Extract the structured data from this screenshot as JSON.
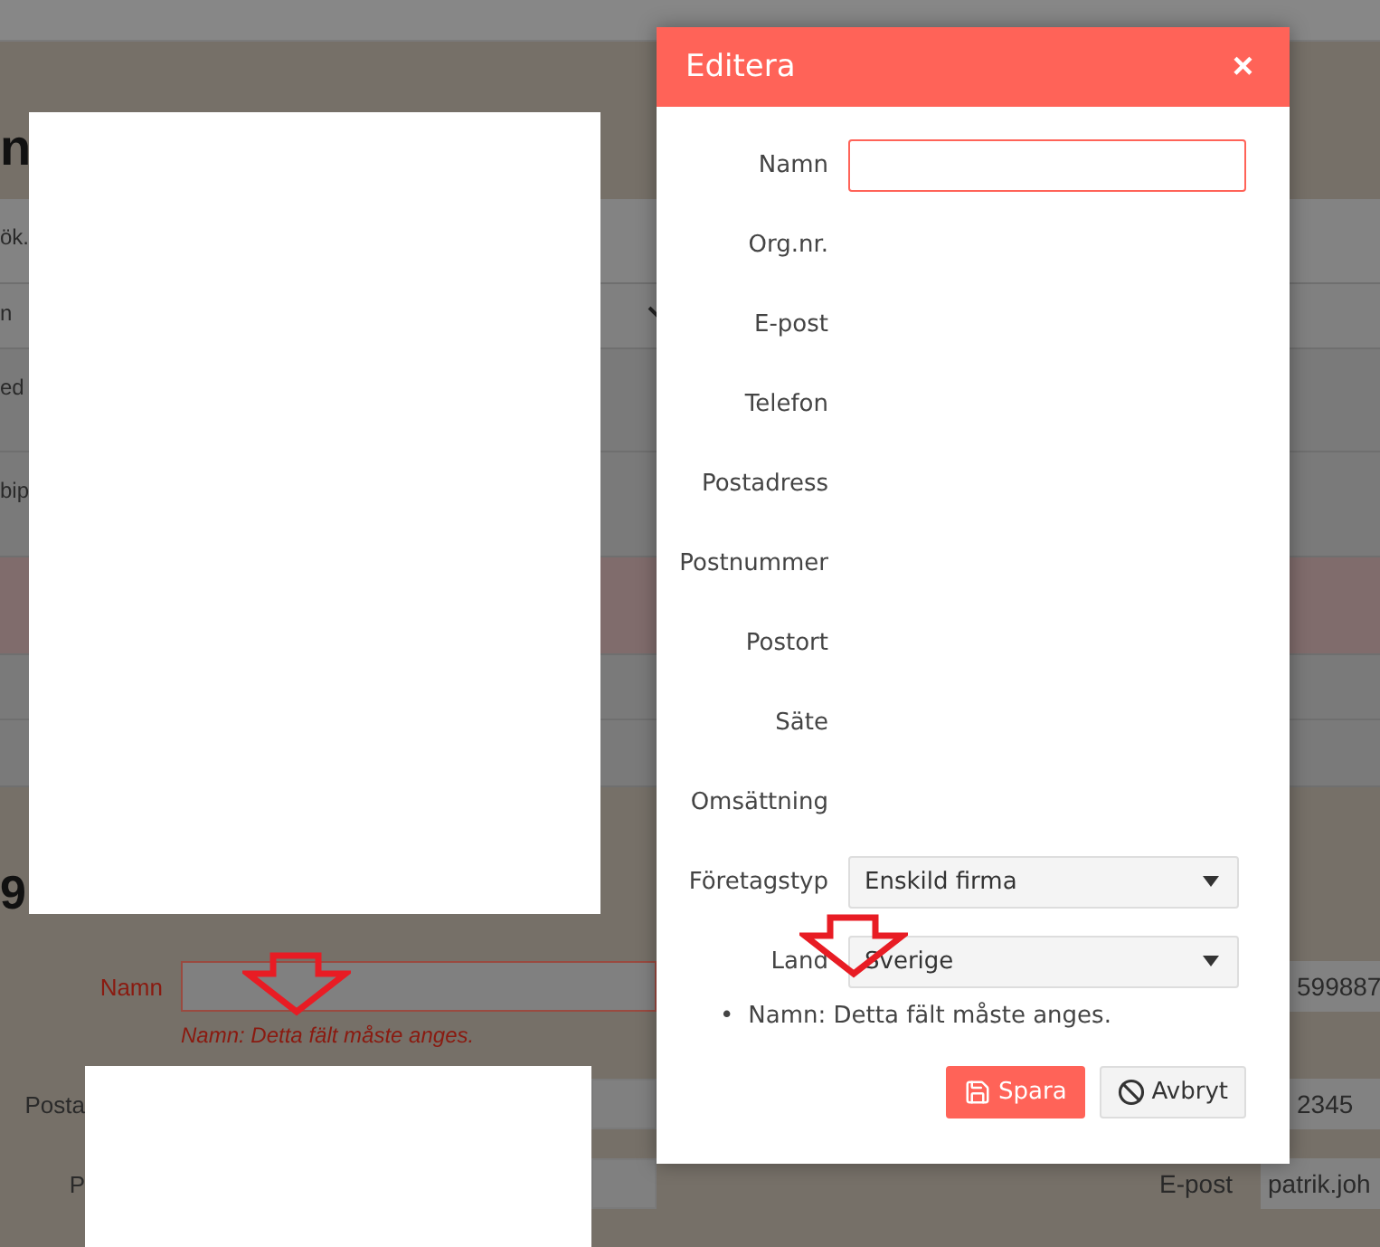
{
  "background": {
    "heading": "n",
    "rows": [
      {
        "kind": "search",
        "text": "ök.",
        "highlighted": false
      },
      {
        "kind": "dropdown",
        "text": "n",
        "highlighted": false
      },
      {
        "kind": "row",
        "text": "ed",
        "highlighted": false
      },
      {
        "kind": "row",
        "text": "bip",
        "highlighted": false
      },
      {
        "kind": "row",
        "highlighted": true
      },
      {
        "kind": "row",
        "highlighted": false
      },
      {
        "kind": "row",
        "highlighted": false
      }
    ],
    "form": {
      "heading": "9",
      "rows": [
        {
          "left_label": "Namn",
          "invalid": true,
          "error": "Namn: Detta fält måste anges.",
          "right_value": "599887"
        },
        {
          "left_label": "Posta",
          "invalid": false,
          "right_value": "2345"
        },
        {
          "left_label": "P",
          "invalid": false,
          "right_label": "E-post",
          "right_value": "patrik.joh"
        }
      ]
    }
  },
  "modal": {
    "title": "Editera",
    "close": "×",
    "fields": [
      {
        "label": "Namn",
        "kind": "input",
        "invalid": true
      },
      {
        "label": "Org.nr.",
        "kind": "blank"
      },
      {
        "label": "E-post",
        "kind": "blank"
      },
      {
        "label": "Telefon",
        "kind": "blank"
      },
      {
        "label": "Postadress",
        "kind": "blank"
      },
      {
        "label": "Postnummer",
        "kind": "blank"
      },
      {
        "label": "Postort",
        "kind": "blank"
      },
      {
        "label": "Säte",
        "kind": "blank"
      },
      {
        "label": "Omsättning",
        "kind": "blank"
      },
      {
        "label": "Företagstyp",
        "kind": "select",
        "value": "Enskild firma"
      },
      {
        "label": "Land",
        "kind": "select",
        "value": "Sverige"
      }
    ],
    "error_bullet": "•",
    "errors": [
      "Namn: Detta fält måste anges."
    ],
    "buttons": [
      {
        "label": "Spara",
        "kind": "primary"
      },
      {
        "label": "Avbryt",
        "kind": "secondary"
      }
    ]
  }
}
